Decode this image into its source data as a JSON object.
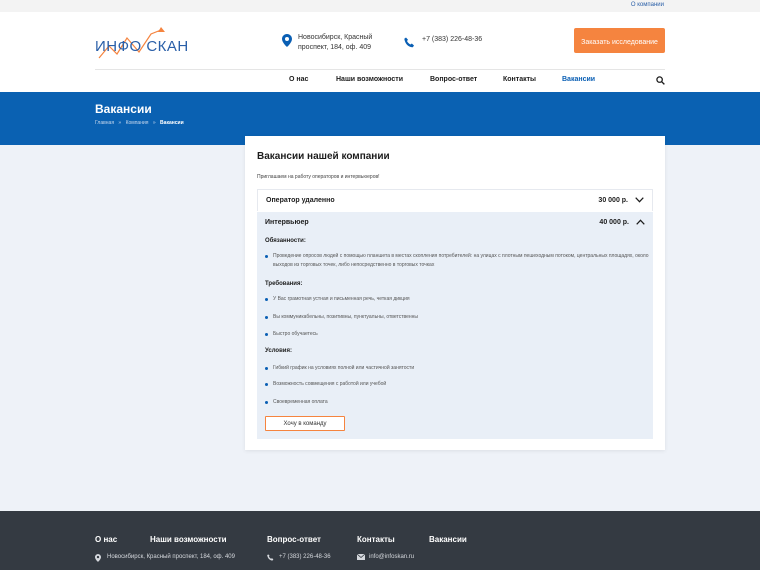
{
  "topbar": {
    "company_link": "О компании"
  },
  "header": {
    "logo_text": "ИНФО СКАН",
    "address": "Новосибирск, Красный проспект, 184, оф. 409",
    "phone": "+7 (383) 226-48-36",
    "order_button": "Заказать исследование"
  },
  "nav": {
    "items": [
      {
        "label": "О нас"
      },
      {
        "label": "Наши возможности"
      },
      {
        "label": "Вопрос-ответ"
      },
      {
        "label": "Контакты"
      },
      {
        "label": "Вакансии",
        "active": true
      }
    ]
  },
  "banner": {
    "title": "Вакансии",
    "crumbs": [
      "Главная",
      "Компания",
      "Вакансии"
    ],
    "separator": "»"
  },
  "content": {
    "title": "Вакансии нашей компании",
    "intro": "Приглашаем на работу операторов и интервьюеров!",
    "jobs": [
      {
        "title": "Оператор удаленно",
        "salary": "30 000 р.",
        "expanded": false
      },
      {
        "title": "Интервьюер",
        "salary": "40 000 р.",
        "expanded": true,
        "duties_title": "Обязанности:",
        "duties": [
          "Проведение опросов людей с помощью планшета в местах скопления потребителей: на улицах с плотным пешеходным потоком, центральных площадях, около выходов из торговых точек, либо непосредственно в торговых точках"
        ],
        "requirements_title": "Требования:",
        "requirements": [
          "У Вас грамотная устная и письменная речь, четкая дикция",
          "Вы коммуникабельны, позитивны, пунктуальны, ответственны",
          "Быстро обучаетесь"
        ],
        "conditions_title": "Условия:",
        "conditions": [
          "Гибкий график на условиях полной или частичной занятости",
          "Возможность совмещения с работой или учебой",
          "Своевременная оплата"
        ],
        "apply_button": "Хочу в команду"
      }
    ]
  },
  "footer": {
    "nav": [
      "О нас",
      "Наши возможности",
      "Вопрос-ответ",
      "Контакты",
      "Вакансии"
    ],
    "address": "Новосибирск, Красный проспект, 184, оф. 409",
    "phone": "+7 (383) 226-48-36",
    "email": "info@infoskan.ru"
  },
  "colors": {
    "primary": "#0a61b2",
    "accent": "#f5843f",
    "footer": "#343a42"
  }
}
